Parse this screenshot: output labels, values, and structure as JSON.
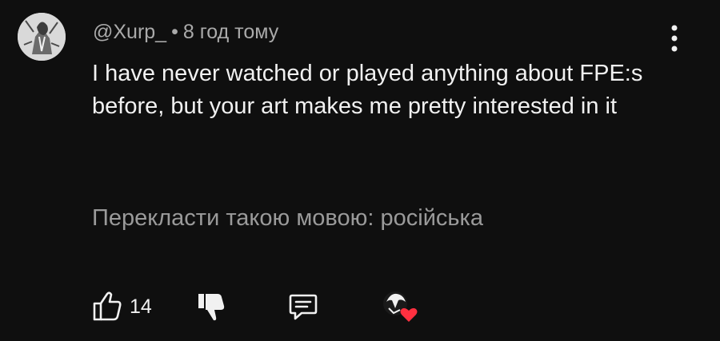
{
  "comment": {
    "author": "@Xurp_",
    "separator": "•",
    "time": "8 год тому",
    "text": "I have never watched or played anything about FPE:s before, but your art makes me pretty interested in it",
    "translate_label": "Перекласти такою мовою: російська"
  },
  "actions": {
    "like_count": "14"
  },
  "icons": {
    "avatar": "avatar-image",
    "menu": "more-vert-icon",
    "like": "thumbs-up-icon",
    "dislike": "thumbs-down-icon",
    "reply": "reply-icon",
    "creator_heart": "creator-heart-icon"
  },
  "colors": {
    "background": "#0f0f0f",
    "text": "#f1f1f1",
    "secondary_text": "#aaaaaa",
    "heart": "#ff3040"
  }
}
